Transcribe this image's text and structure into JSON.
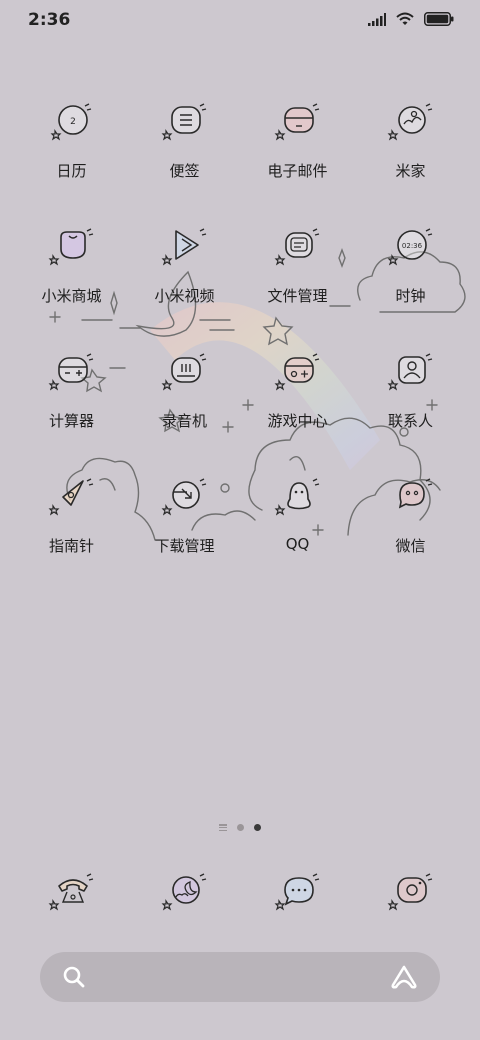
{
  "status": {
    "time": "2:36"
  },
  "apps": [
    {
      "label": "日历",
      "icon": "calendar-icon",
      "text": "2"
    },
    {
      "label": "便签",
      "icon": "notes-icon"
    },
    {
      "label": "电子邮件",
      "icon": "email-icon"
    },
    {
      "label": "米家",
      "icon": "mijia-icon"
    },
    {
      "label": "小米商城",
      "icon": "mi-store-icon"
    },
    {
      "label": "小米视频",
      "icon": "mi-video-icon"
    },
    {
      "label": "文件管理",
      "icon": "file-manager-icon"
    },
    {
      "label": "时钟",
      "icon": "clock-icon",
      "text": "02:36"
    },
    {
      "label": "计算器",
      "icon": "calculator-icon"
    },
    {
      "label": "录音机",
      "icon": "recorder-icon"
    },
    {
      "label": "游戏中心",
      "icon": "game-center-icon"
    },
    {
      "label": "联系人",
      "icon": "contacts-icon"
    },
    {
      "label": "指南针",
      "icon": "compass-icon"
    },
    {
      "label": "下载管理",
      "icon": "downloads-icon"
    },
    {
      "label": "QQ",
      "icon": "qq-icon"
    },
    {
      "label": "微信",
      "icon": "wechat-icon"
    }
  ],
  "dock": [
    {
      "icon": "phone-icon"
    },
    {
      "icon": "weather-icon"
    },
    {
      "icon": "messages-icon"
    },
    {
      "icon": "camera-icon"
    }
  ],
  "page_indicator": {
    "pages": 2,
    "current": 2
  },
  "colors": {
    "background": "#cdc8cf",
    "line": "#2a2a2a",
    "rainbow": [
      "#f4b8b8",
      "#f6dcb0",
      "#d9e8c6",
      "#c4d8f0",
      "#d4c4f0"
    ]
  }
}
